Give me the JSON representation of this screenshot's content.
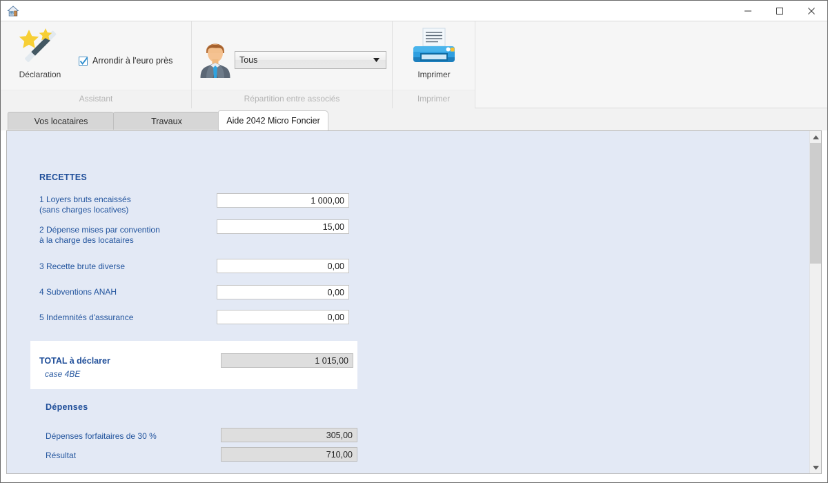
{
  "window": {
    "app_icon": "home-icon",
    "title": "",
    "controls": {
      "minimize": "–",
      "maximize": "☐",
      "close": "✕"
    }
  },
  "ribbon": {
    "groups": [
      {
        "id": "assistant",
        "title": "Assistant",
        "button": {
          "label": "Déclaration",
          "icon": "magic-wand-icon"
        },
        "checkbox": {
          "label": "Arrondir à l'euro près",
          "checked": true
        }
      },
      {
        "id": "repartition",
        "title": "Répartition entre associés",
        "icon": "businessman-avatar-icon",
        "dropdown": {
          "value": "Tous",
          "options": [
            "Tous"
          ]
        }
      },
      {
        "id": "imprimer",
        "title": "Imprimer",
        "button": {
          "label": "Imprimer",
          "icon": "printer-icon"
        }
      }
    ]
  },
  "tabs": [
    {
      "label": "Vos locataires",
      "active": false
    },
    {
      "label": "Travaux",
      "active": false
    },
    {
      "label": "Aide 2042 Micro Foncier",
      "active": true
    }
  ],
  "form": {
    "recettes_title": "RECETTES",
    "rows": [
      {
        "label": "1 Loyers bruts encaissés\n(sans charges locatives)",
        "value": "1 000,00",
        "readonly": false
      },
      {
        "label": "2 Dépense mises par convention\nà la charge des locataires",
        "value": "15,00",
        "readonly": false
      },
      {
        "label": "3 Recette brute diverse",
        "value": "0,00",
        "readonly": false
      },
      {
        "label": "4 Subventions ANAH",
        "value": "0,00",
        "readonly": false
      },
      {
        "label": "5 Indemnités d'assurance",
        "value": "0,00",
        "readonly": false
      }
    ],
    "total": {
      "title": "TOTAL à déclarer",
      "subtitle": "case 4BE",
      "value": "1 015,00"
    },
    "depenses_title": "Dépenses",
    "depenses_rows": [
      {
        "label": "Dépenses forfaitaires de 30 %",
        "value": "305,00",
        "readonly": true
      },
      {
        "label": "Résultat",
        "value": "710,00",
        "readonly": true
      }
    ]
  },
  "scrollbar": {
    "up_arrow": "▲",
    "down_arrow": "▼"
  },
  "colors": {
    "accent_blue": "#23559e",
    "heading_blue": "#1f4e99",
    "content_bg": "#e3e9f5",
    "ribbon_bg": "#f6f6f6"
  }
}
